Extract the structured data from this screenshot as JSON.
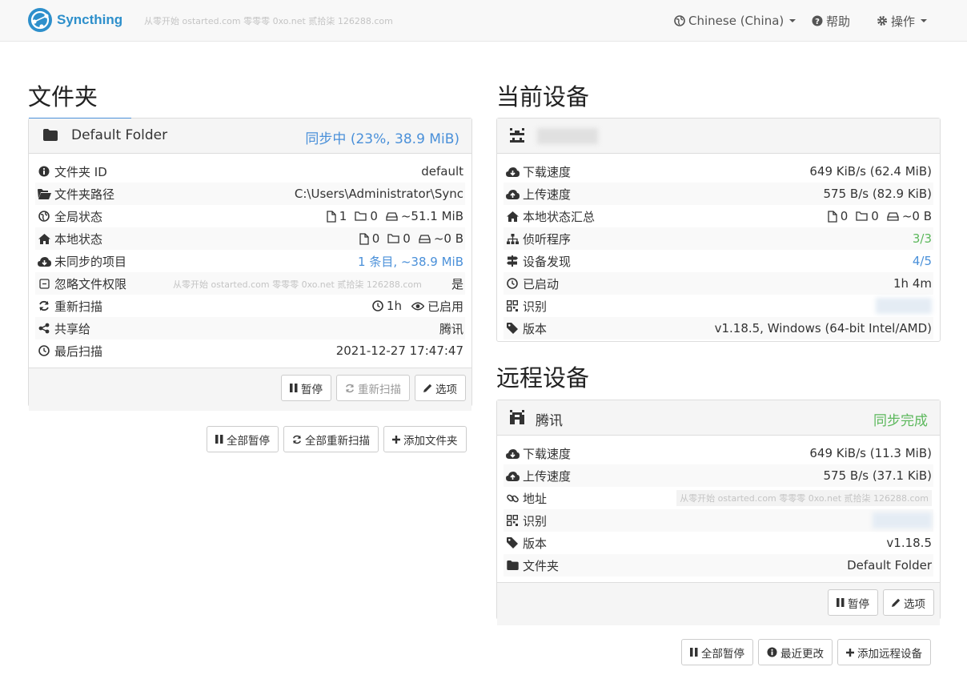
{
  "nav": {
    "brand": "Syncthing",
    "watermark": "从零开始 ostarted.com 零零零 0xo.net 贰拾柒 126288.com",
    "language": "Chinese (China)",
    "help": "帮助",
    "actions": "操作"
  },
  "folders_section": {
    "title": "文件夹",
    "folder": {
      "name": "Default Folder",
      "status": "同步中 (23%, 38.9 MiB)",
      "rows": [
        {
          "label": "文件夹 ID",
          "value": "default"
        },
        {
          "label": "文件夹路径",
          "value": "C:\\Users\\Administrator\\Sync"
        },
        {
          "label": "全局状态",
          "files": "1",
          "dirs": "0",
          "size": "~51.1 MiB"
        },
        {
          "label": "本地状态",
          "files": "0",
          "dirs": "0",
          "size": "~0 B"
        },
        {
          "label": "未同步的项目",
          "value": "1 条目, ~38.9 MiB"
        },
        {
          "label": "忽略文件权限",
          "value": "是",
          "watermark": "从零开始 ostarted.com 零零零 0xo.net 贰拾柒 126288.com"
        },
        {
          "label": "重新扫描",
          "interval": "1h",
          "watch": "已启用"
        },
        {
          "label": "共享给",
          "value": "腾讯"
        },
        {
          "label": "最后扫描",
          "value": "2021-12-27 17:47:47"
        }
      ],
      "buttons": {
        "pause": "暂停",
        "rescan": "重新扫描",
        "options": "选项"
      }
    },
    "actions": {
      "pause_all": "全部暂停",
      "rescan_all": "全部重新扫描",
      "add_folder": "添加文件夹"
    }
  },
  "this_device": {
    "title": "当前设备",
    "rows": [
      {
        "label": "下载速度",
        "value": "649 KiB/s (62.4 MiB)"
      },
      {
        "label": "上传速度",
        "value": "575 B/s (82.9 KiB)"
      },
      {
        "label": "本地状态汇总",
        "files": "0",
        "dirs": "0",
        "size": "~0 B"
      },
      {
        "label": "侦听程序",
        "value": "3/3"
      },
      {
        "label": "设备发现",
        "value": "4/5"
      },
      {
        "label": "已启动",
        "value": "1h 4m"
      },
      {
        "label": "识别",
        "value": ""
      },
      {
        "label": "版本",
        "value": "v1.18.5, Windows (64-bit Intel/AMD)"
      }
    ]
  },
  "remote_devices": {
    "title": "远程设备",
    "device": {
      "name": "腾讯",
      "status": "同步完成",
      "rows": [
        {
          "label": "下载速度",
          "value": "649 KiB/s (11.3 MiB)"
        },
        {
          "label": "上传速度",
          "value": "575 B/s (37.1 KiB)"
        },
        {
          "label": "地址",
          "value": "从零开始 ostarted.com 零零零 0xo.net 贰拾柒 126288.com"
        },
        {
          "label": "识别",
          "value": ""
        },
        {
          "label": "版本",
          "value": "v1.18.5"
        },
        {
          "label": "文件夹",
          "value": "Default Folder"
        }
      ],
      "buttons": {
        "pause": "暂停",
        "options": "选项"
      }
    },
    "actions": {
      "pause_all": "全部暂停",
      "recent_changes": "最近更改",
      "add_device": "添加远程设备"
    }
  },
  "colors": {
    "brand": "#2d8fcb",
    "syncing": "#4a90d9",
    "up_to_date": "#5cb85c"
  }
}
